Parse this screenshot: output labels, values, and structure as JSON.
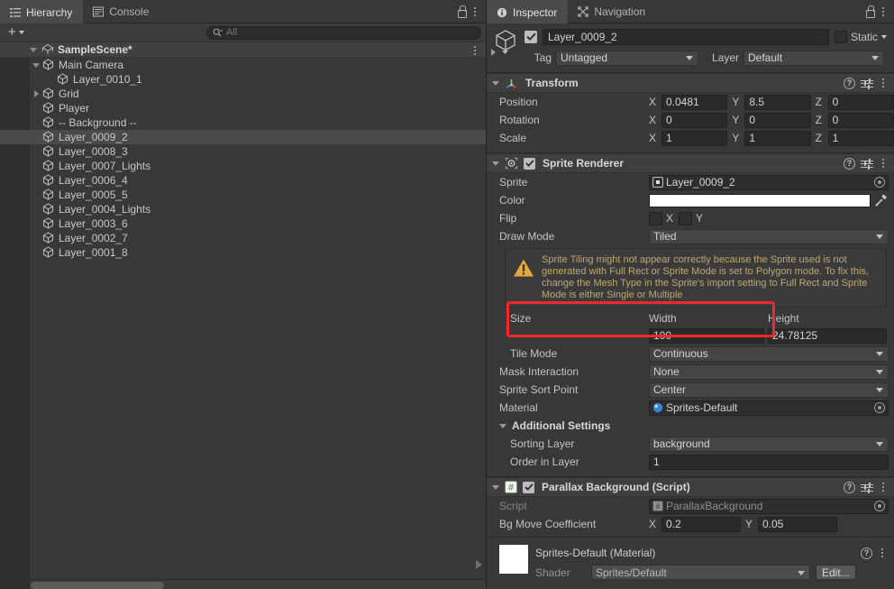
{
  "hierarchy": {
    "tabs": [
      {
        "label": "Hierarchy",
        "icon": "hierarchy-icon",
        "active": true
      },
      {
        "label": "Console",
        "icon": "console-icon",
        "active": false
      }
    ],
    "toolbar": {
      "create_label": "+",
      "search_placeholder": "All",
      "search_value": ""
    },
    "scene": {
      "name": "SampleScene*",
      "expanded": true
    },
    "items": [
      {
        "label": "Main Camera",
        "indent": 1,
        "twisty": "down",
        "selected": false
      },
      {
        "label": "Layer_0010_1",
        "indent": 2,
        "twisty": "none",
        "selected": false
      },
      {
        "label": "Grid",
        "indent": 1,
        "twisty": "right",
        "selected": false
      },
      {
        "label": "Player",
        "indent": 1,
        "twisty": "none",
        "selected": false
      },
      {
        "label": "-- Background --",
        "indent": 1,
        "twisty": "none",
        "selected": false
      },
      {
        "label": "Layer_0009_2",
        "indent": 1,
        "twisty": "none",
        "selected": true
      },
      {
        "label": "Layer_0008_3",
        "indent": 1,
        "twisty": "none",
        "selected": false
      },
      {
        "label": "Layer_0007_Lights",
        "indent": 1,
        "twisty": "none",
        "selected": false
      },
      {
        "label": "Layer_0006_4",
        "indent": 1,
        "twisty": "none",
        "selected": false
      },
      {
        "label": "Layer_0005_5",
        "indent": 1,
        "twisty": "none",
        "selected": false
      },
      {
        "label": "Layer_0004_Lights",
        "indent": 1,
        "twisty": "none",
        "selected": false
      },
      {
        "label": "Layer_0003_6",
        "indent": 1,
        "twisty": "none",
        "selected": false
      },
      {
        "label": "Layer_0002_7",
        "indent": 1,
        "twisty": "none",
        "selected": false
      },
      {
        "label": "Layer_0001_8",
        "indent": 1,
        "twisty": "none",
        "selected": false
      }
    ]
  },
  "inspector": {
    "tabs": [
      {
        "label": "Inspector",
        "icon": "info-icon",
        "active": true
      },
      {
        "label": "Navigation",
        "icon": "navigation-icon",
        "active": false
      }
    ],
    "object": {
      "enabled": true,
      "name": "Layer_0009_2",
      "static_label": "Static",
      "static_checked": false,
      "tag_label": "Tag",
      "tag_value": "Untagged",
      "layer_label": "Layer",
      "layer_value": "Default"
    },
    "transform": {
      "title": "Transform",
      "position_label": "Position",
      "position": {
        "x": "0.0481",
        "y": "8.5",
        "z": "0"
      },
      "rotation_label": "Rotation",
      "rotation": {
        "x": "0",
        "y": "0",
        "z": "0"
      },
      "scale_label": "Scale",
      "scale": {
        "x": "1",
        "y": "1",
        "z": "1"
      },
      "axis_x": "X",
      "axis_y": "Y",
      "axis_z": "Z"
    },
    "sprite_renderer": {
      "title": "Sprite Renderer",
      "enabled": true,
      "sprite_label": "Sprite",
      "sprite_value": "Layer_0009_2",
      "color_label": "Color",
      "color_value": "#FFFFFF",
      "flip_label": "Flip",
      "flip_x_label": "X",
      "flip_y_label": "Y",
      "flip_x": false,
      "flip_y": false,
      "draw_mode_label": "Draw Mode",
      "draw_mode_value": "Tiled",
      "warning": "Sprite Tiling might not appear correctly because the Sprite used is not generated with Full Rect or Sprite Mode is set to Polygon mode. To fix this, change the Mesh Type in the Sprite's import setting to Full Rect and Sprite Mode is either Single or Multiple",
      "size_label": "Size",
      "width_label": "Width",
      "width_value": "100",
      "height_label": "Height",
      "height_value": "24.78125",
      "tile_mode_label": "Tile Mode",
      "tile_mode_value": "Continuous",
      "mask_interaction_label": "Mask Interaction",
      "mask_interaction_value": "None",
      "sprite_sort_point_label": "Sprite Sort Point",
      "sprite_sort_point_value": "Center",
      "material_label": "Material",
      "material_value": "Sprites-Default",
      "additional_settings_label": "Additional Settings",
      "sorting_layer_label": "Sorting Layer",
      "sorting_layer_value": "background",
      "order_in_layer_label": "Order in Layer",
      "order_in_layer_value": "1"
    },
    "parallax": {
      "title": "Parallax Background (Script)",
      "enabled": true,
      "script_label": "Script",
      "script_value": "ParallaxBackground",
      "coefficient_label": "Bg Move Coefficient",
      "coefficient": {
        "x": "0.2",
        "y": "0.05"
      },
      "axis_x": "X",
      "axis_y": "Y"
    },
    "material_preview": {
      "title": "Sprites-Default (Material)",
      "shader_label": "Shader",
      "shader_value": "Sprites/Default",
      "edit_label": "Edit..."
    }
  },
  "annotation": {
    "highlight_color": "#F0282D",
    "target": "size-width-row"
  }
}
